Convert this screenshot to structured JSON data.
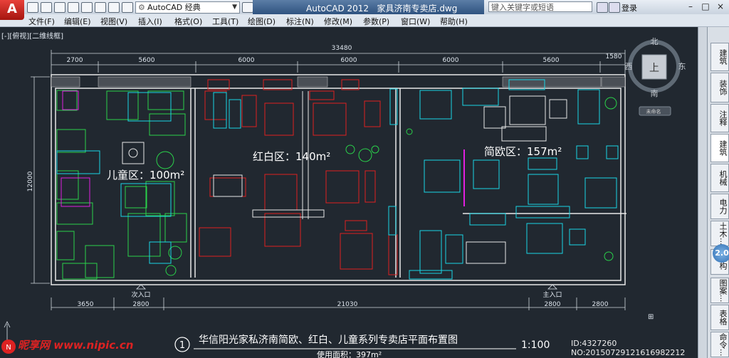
{
  "app": {
    "logo": "A",
    "title": "AutoCAD 2012",
    "file": "家具济南专卖店.dwg"
  },
  "titlebar": {
    "workspace": "AutoCAD 经典",
    "search_placeholder": "键入关键字或短语",
    "login": "登录",
    "window_buttons": [
      "–",
      "□",
      "×"
    ]
  },
  "menu": [
    "文件(F)",
    "编辑(E)",
    "视图(V)",
    "插入(I)",
    "格式(O)",
    "工具(T)",
    "绘图(D)",
    "标注(N)",
    "修改(M)",
    "参数(P)",
    "窗口(W)",
    "帮助(H)"
  ],
  "viewport": {
    "label": "[-][俯视][二维线框]"
  },
  "viewcube": {
    "north": "北",
    "south": "南",
    "west": "西",
    "east": "东",
    "top": "上",
    "ucs": "未命名"
  },
  "dimensions": {
    "overall_width": "33480",
    "top": [
      "2700",
      "5600",
      "6000",
      "6000",
      "6000",
      "5600",
      "1580"
    ],
    "left": "12000",
    "bottom": [
      "3650",
      "2800",
      "21030",
      "2800",
      "2800"
    ]
  },
  "zones": [
    {
      "name": "儿童区：100m²"
    },
    {
      "name": "红白区：140m²"
    },
    {
      "name": "简欧区：157m²"
    }
  ],
  "entrances": [
    "次入口",
    "主入口"
  ],
  "title_block": {
    "number": "1",
    "title": "华信阳光家私济南简欧、红白、儿童系列专卖店平面布置图",
    "scale": "1:100",
    "area": "使用面积：397m²"
  },
  "right_tabs": [
    "建筑",
    "装饰",
    "注释",
    "建筑",
    "机械",
    "电力",
    "土木...",
    "结构",
    "图案...",
    "表格",
    "命令..."
  ],
  "zoom_badge": "2.0",
  "watermark": {
    "site": "昵享网 www.nipic.cn",
    "id": "ID:4327260 NO:20150729121616982212"
  },
  "colors": {
    "background": "#212830",
    "wall": "#e8e8e8",
    "red": "#e02020",
    "cyan": "#19d6e6",
    "green": "#2ad24a",
    "magenta": "#e020e0"
  }
}
